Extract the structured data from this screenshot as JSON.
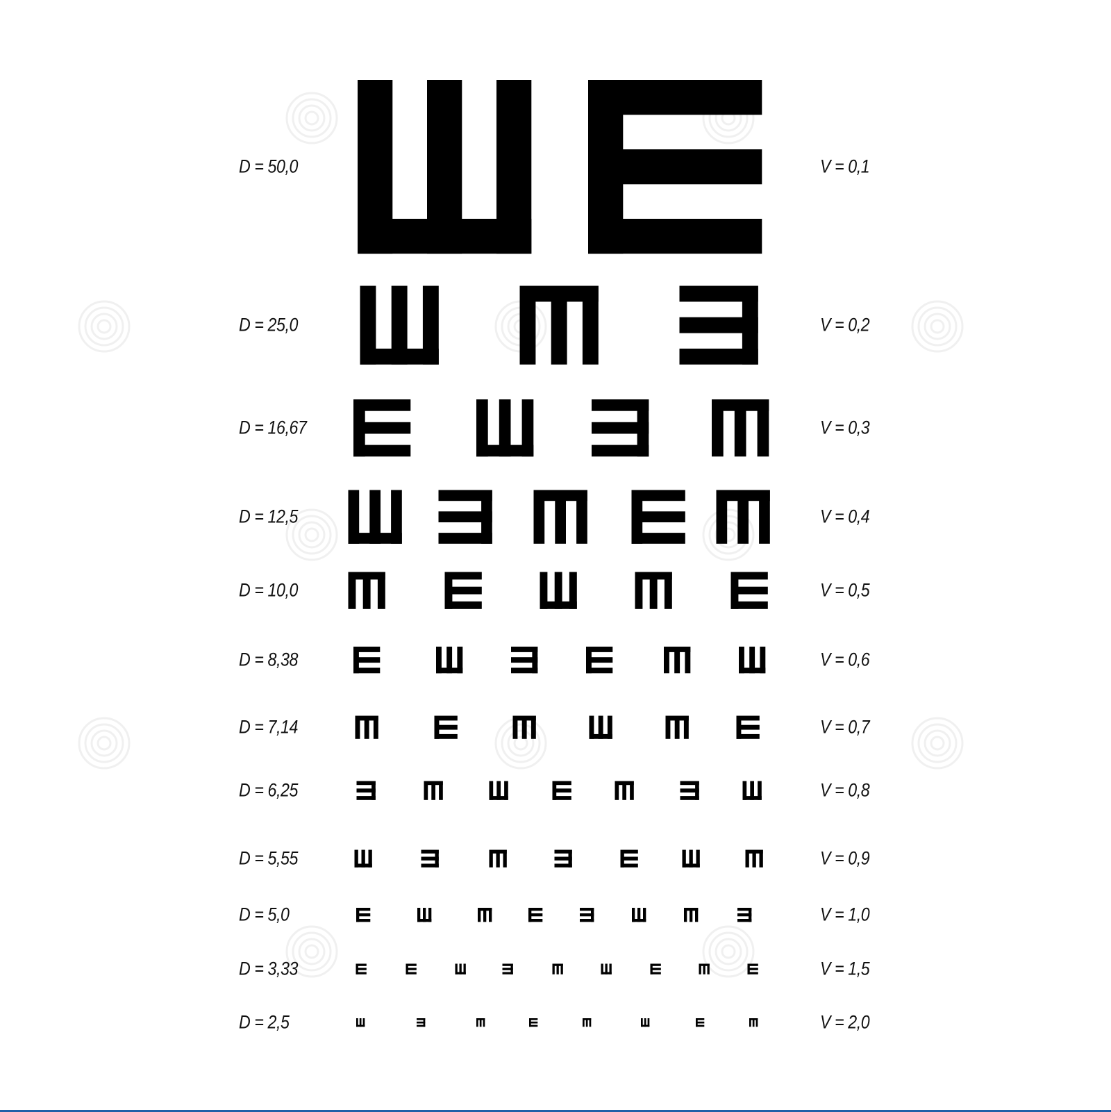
{
  "colors": {
    "optotype": "#000000",
    "background": "#ffffff",
    "text": "#111111",
    "bottom_bar": "#1f5fa8"
  },
  "rows": [
    {
      "d": "D = 50,0",
      "v": "V = 0,1",
      "letters": [
        "W",
        "E"
      ]
    },
    {
      "d": "D = 25,0",
      "v": "V = 0,2",
      "letters": [
        "W",
        "M",
        "3"
      ]
    },
    {
      "d": "D = 16,67",
      "v": "V = 0,3",
      "letters": [
        "E",
        "W",
        "3",
        "M"
      ]
    },
    {
      "d": "D = 12,5",
      "v": "V = 0,4",
      "letters": [
        "W",
        "3",
        "M",
        "E",
        "M"
      ]
    },
    {
      "d": "D = 10,0",
      "v": "V = 0,5",
      "letters": [
        "M",
        "E",
        "W",
        "M",
        "E"
      ]
    },
    {
      "d": "D = 8,38",
      "v": "V = 0,6",
      "letters": [
        "E",
        "W",
        "3",
        "E",
        "M",
        "W"
      ]
    },
    {
      "d": "D = 7,14",
      "v": "V = 0,7",
      "letters": [
        "M",
        "E",
        "M",
        "W",
        "M",
        "E"
      ]
    },
    {
      "d": "D = 6,25",
      "v": "V = 0,8",
      "letters": [
        "3",
        "M",
        "W",
        "E",
        "M",
        "3",
        "W"
      ]
    },
    {
      "d": "D = 5,55",
      "v": "V = 0,9",
      "letters": [
        "W",
        "3",
        "M",
        "3",
        "E",
        "W",
        "M"
      ]
    },
    {
      "d": "D = 5,0",
      "v": "V = 1,0",
      "letters": [
        "E",
        "W",
        "M",
        "E",
        "3",
        "W",
        "M",
        "3"
      ]
    },
    {
      "d": "D = 3,33",
      "v": "V = 1,5",
      "letters": [
        "E",
        "E",
        "W",
        "3",
        "M",
        "W",
        "E",
        "M",
        "E"
      ]
    },
    {
      "d": "D = 2,5",
      "v": "V = 2,0",
      "letters": [
        "W",
        "3",
        "M",
        "E",
        "M",
        "W",
        "E",
        "M"
      ]
    }
  ]
}
